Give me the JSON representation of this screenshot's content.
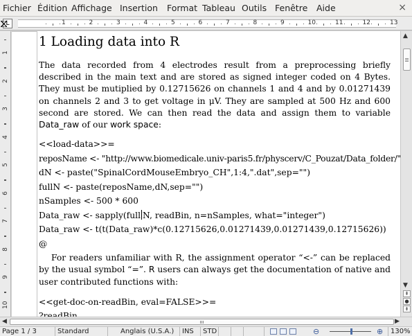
{
  "menu": {
    "items": [
      "Fichier",
      "Édition",
      "Affichage",
      "Insertion",
      "Format",
      "Tableau",
      "Outils",
      "Fenêtre",
      "Aide"
    ],
    "close_glyph": "×"
  },
  "ruler": {
    "corner_glyph": "L",
    "numbers": [
      "1",
      "2",
      "3",
      "4",
      "5",
      "6",
      "7",
      "8",
      "9",
      "10",
      "11",
      "12",
      "13"
    ],
    "vertical_numbers": [
      "1",
      "2",
      "3",
      "4",
      "5",
      "6",
      "7",
      "8",
      "9",
      "10"
    ]
  },
  "document": {
    "heading": "1 Loading data into R",
    "para1_a": "The data recorded from 4 electrodes result from a preprocessing briefly described in the main text and are stored as signed integer coded on 4 Bytes. They must be mutiplied by 0.12715626 on channels 1 and 4 and by 0.01271439 on channels 2 and 3 to get voltage in μV. They are sampled at 500 Hz and 600 second are stored. We can then read the data and assign them to variable ",
    "para1_var": "Data_raw",
    "para1_b": " of our ",
    "para1_ws": "work space",
    "para1_c": ":",
    "code1": [
      "<<load-data>>=",
      "reposName <- \"http://www.biomedicale.univ-paris5.fr/physcerv/C_Pouzat/Data_folder/\"",
      "dN <- paste(\"SpinalCordMouseEmbryo_CH\",1:4,\".dat\",sep=\"\")",
      "fullN <- paste(reposName,dN,sep=\"\")",
      "nSamples <- 500 * 600"
    ],
    "code1_cursor_before": "Data_raw <- sapply(full",
    "code1_cursor_after": "N, readBin, n=nSamples, what=\"integer\")",
    "code1_tail": [
      "Data_raw <- t(t(Data_raw)*c(0.12715626,0.01271439,0.01271439,0.12715626))",
      "@"
    ],
    "para2_a": "For readers unfamiliar with R, the assignment operator “<-” can be replaced by the usual symbol “=”. ",
    "para2_r": "R",
    "para2_b": " users can always get the documentation of native and user contributed functions with:",
    "code2": [
      "<<get-doc-on-readBin, eval=FALSE>>=",
      "?readBin",
      "@"
    ]
  },
  "status": {
    "page": "Page 1 / 3",
    "style": "Standard",
    "language": "Anglais (U.S.A.)",
    "insert_mode": "INS",
    "selection_mode": "STD",
    "zoom": "130%"
  }
}
